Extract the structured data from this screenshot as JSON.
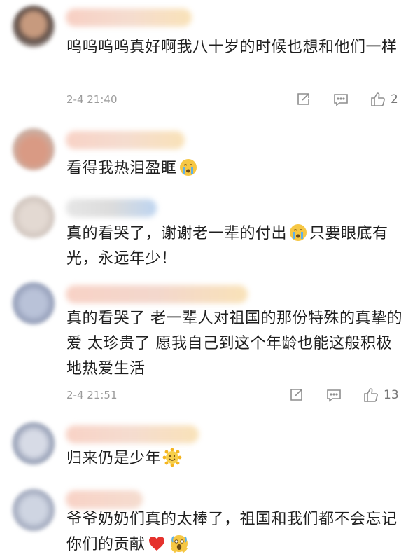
{
  "colors": {
    "text": "#1f1f1f",
    "meta": "#9b9b9b",
    "icon": "#8e8e8e"
  },
  "comments": [
    {
      "text": "呜呜呜呜真好啊我八十岁的时候也想和他们一样",
      "time": "2-4 21:40",
      "likes": "2",
      "icons": [
        "share-icon",
        "comment-icon",
        "like-icon"
      ]
    },
    {
      "text": "看得我热泪盈眶",
      "emoji": "crying-face-emoji"
    },
    {
      "text_a": "真的看哭了，谢谢老一辈的付出",
      "text_b": "只要眼底有光，永远年少！",
      "emoji": "crying-face-emoji"
    },
    {
      "text": "真的看哭了 老一辈人对祖国的那份特殊的真挚的爱 太珍贵了 愿我自己到这个年龄也能这般积极地热爱生活",
      "time": "2-4 21:51",
      "likes": "13",
      "icons": [
        "share-icon",
        "comment-icon",
        "like-icon"
      ]
    },
    {
      "text": "归来仍是少年",
      "emoji": "sun-emoji"
    },
    {
      "text": "爷爷奶奶们真的太棒了，祖国和我们都不会忘记你们的贡献",
      "emoji": [
        "red-heart-emoji",
        "screaming-face-emoji"
      ]
    }
  ]
}
